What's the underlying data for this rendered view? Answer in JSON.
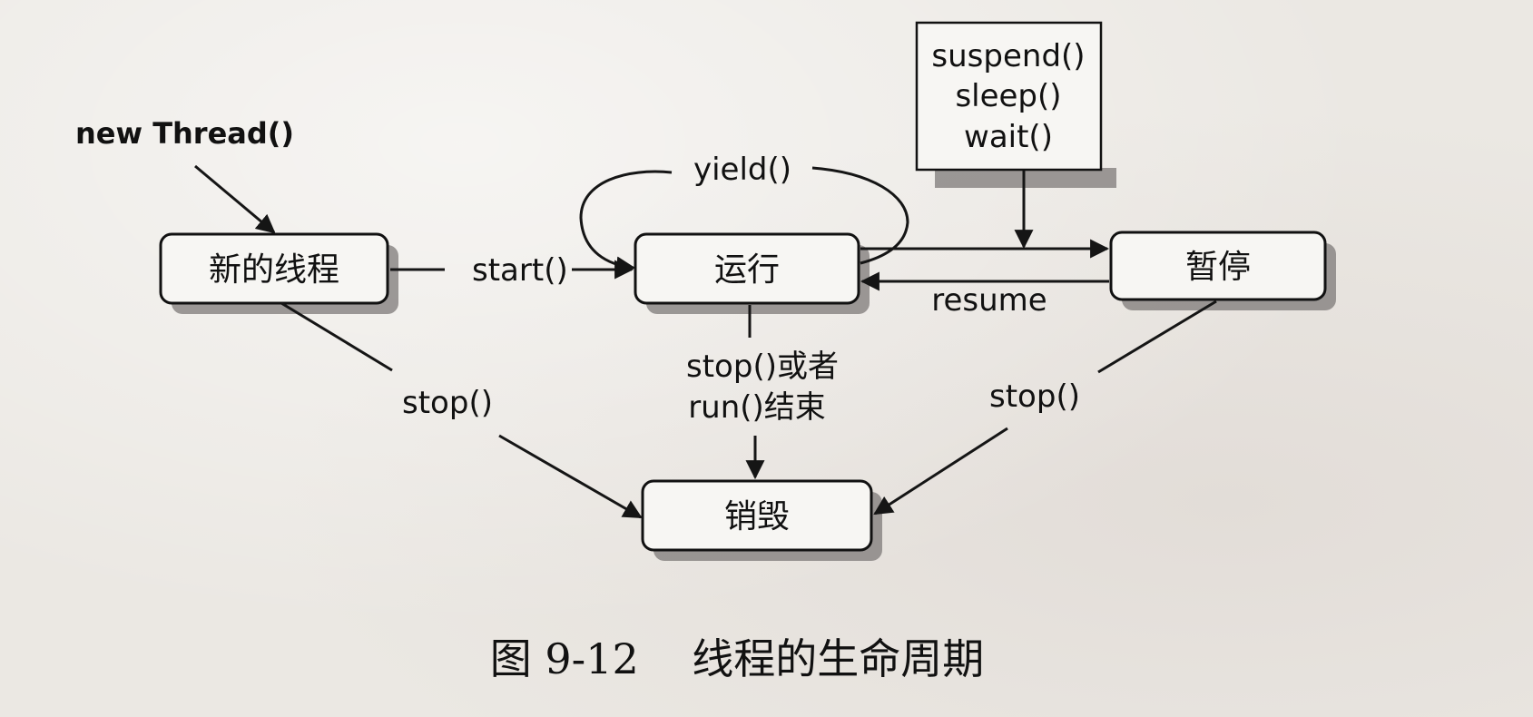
{
  "nodes": {
    "new_thread": "新的线程",
    "running": "运行",
    "paused": "暂停",
    "destroyed": "销毁"
  },
  "labels": {
    "new_thread_call": "new Thread()",
    "start": "start()",
    "yield": "yield()",
    "resume": "resume",
    "stop_left": "stop()",
    "stop_right": "stop()",
    "stop_or_line1": "stop()或者",
    "stop_or_line2": "run()结束"
  },
  "pause_methods": [
    "suspend()",
    "sleep()",
    "wait()"
  ],
  "caption": "图 9-12    线程的生命周期"
}
